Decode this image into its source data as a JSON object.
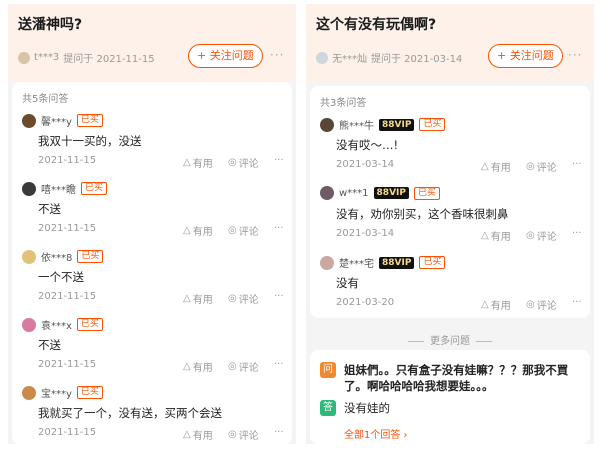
{
  "left": {
    "question": {
      "title": "送潘神吗?",
      "user": "t***3",
      "asked": "提问于 2021-11-15",
      "follow_label": "+ 关注问题",
      "more": "···"
    },
    "answer_count": "共5条问答",
    "answers": [
      {
        "user": "馨***y",
        "tag": "已买",
        "text": "我双十一买的，没送",
        "date": "2021-11-15",
        "useful": "有用",
        "comment": "评论",
        "more": "···"
      },
      {
        "user": "嘻***瞻",
        "tag": "已买",
        "text": "不送",
        "date": "2021-11-15",
        "useful": "有用",
        "comment": "评论",
        "more": "···"
      },
      {
        "user": "依***8",
        "tag": "已买",
        "text": "一个不送",
        "date": "2021-11-15",
        "useful": "有用",
        "comment": "评论",
        "more": "···"
      },
      {
        "user": "袁***x",
        "tag": "已买",
        "text": "不送",
        "date": "2021-11-15",
        "useful": "有用",
        "comment": "评论",
        "more": "···"
      },
      {
        "user": "宝***y",
        "tag": "已买",
        "text": "我就买了一个，没有送，买两个会送",
        "date": "2021-11-15",
        "useful": "有用",
        "comment": "评论",
        "more": "···"
      }
    ]
  },
  "right": {
    "question": {
      "title": "这个有没有玩偶啊?",
      "user": "无***灿",
      "asked": "提问于 2021-03-14",
      "follow_label": "+ 关注问题",
      "more": "···"
    },
    "answer_count": "共3条问答",
    "answers": [
      {
        "user": "熊***牛",
        "vip": "88VIP",
        "tag": "已买",
        "text": "没有哎～…!",
        "date": "2021-03-14",
        "useful": "有用",
        "comment": "评论",
        "more": "···"
      },
      {
        "user": "w***1",
        "vip": "88VIP",
        "tag": "已买",
        "text": "没有，劝你别买，这个香味很刺鼻",
        "date": "2021-03-14",
        "useful": "有用",
        "comment": "评论",
        "more": "···"
      },
      {
        "user": "楚***宅",
        "vip": "88VIP",
        "tag": "已买",
        "text": "没有",
        "date": "2021-03-20",
        "useful": "有用",
        "comment": "评论",
        "more": "···"
      }
    ],
    "more_questions_label": "更多问题",
    "more_question": {
      "q_badge": "问",
      "q_text": "姐妹們。。只有盒子没有娃嘛？？？那我不買了。啊哈哈哈哈我想要娃。。。",
      "a_badge": "答",
      "a_text": "没有娃的",
      "link": "全部1个回答 ›"
    }
  },
  "colors": {
    "accent": "#ff5000",
    "header_bg": "#fdf1ea",
    "vip_bg": "#111111",
    "vip_text": "#f5d98b",
    "q_badge": "#f08a2a",
    "a_badge": "#2fb87a"
  },
  "icons": {
    "useful": "thumb-triangle-icon",
    "comment": "comment-bubble-icon"
  }
}
